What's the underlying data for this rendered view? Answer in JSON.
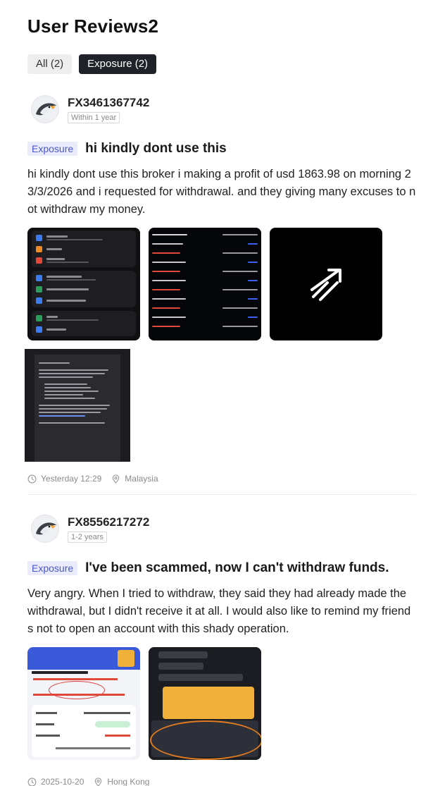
{
  "page": {
    "title": "User Reviews2"
  },
  "filters": [
    {
      "label": "All (2)",
      "active": false
    },
    {
      "label": "Exposure (2)",
      "active": true
    }
  ],
  "reviews": [
    {
      "username": "FX3461367742",
      "tenure": "Within 1 year",
      "tag": "Exposure",
      "title": "hi kindly dont use this",
      "body": "hi kindly dont use this broker i making a profit of usd 1863.98 on morning 23/3/2026 and i requested for withdrawal. and they giving many excuses to not withdraw my money.",
      "images": [
        "settings-menu-screenshot",
        "trade-history-screenshot",
        "expand-images-icon",
        "email-screenshot"
      ],
      "time": "Yesterday 12:29",
      "location": "Malaysia"
    },
    {
      "username": "FX8556217272",
      "tenure": "1-2 years",
      "tag": "Exposure",
      "title": "I've been scammed, now I can't withdraw funds.",
      "body": "Very angry. When I tried to withdraw, they said they had already made the withdrawal, but I didn't receive it at all. I would also like to remind my friends not to open an account with this shady operation.",
      "images": [
        "transaction-details-screenshot",
        "chat-screenshot"
      ],
      "time": "2025-10-20",
      "location": "Hong Kong"
    }
  ]
}
